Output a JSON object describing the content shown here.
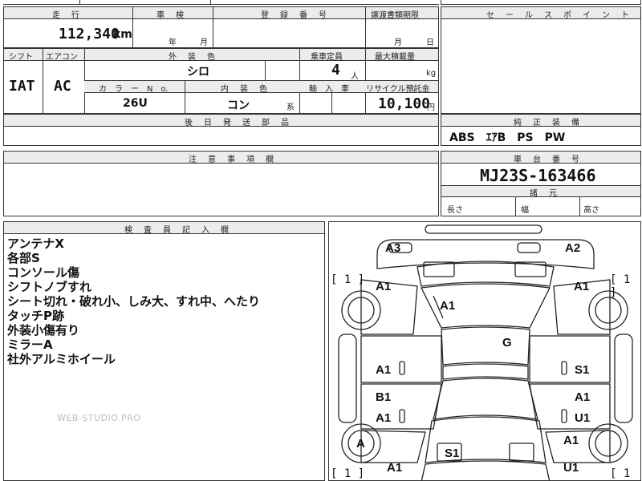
{
  "top_fragment": "",
  "mileage_block": {
    "header_mileage": "走　行",
    "header_inspection": "車　検",
    "header_reg_no": "登　録　番　号",
    "header_transfer_deadline": "譲渡書類期限",
    "mileage_value": "112,340",
    "mileage_unit": "km",
    "year_unit": "年",
    "month_unit": "月",
    "deadline_month": "月",
    "deadline_day": "日"
  },
  "spec_block": {
    "shift_header": "シフト",
    "aircon_header": "エアコン",
    "exterior_color_header": "外　装　色",
    "capacity_header": "乗車定員",
    "max_load_header": "最大積載量",
    "shift_value": "IAT",
    "aircon_value": "AC",
    "exterior_color_value": "シロ",
    "capacity_value": "4",
    "capacity_unit": "人",
    "load_unit": "kg",
    "color_no_header": "カ　ラ　ー　N　o.",
    "interior_color_header": "内　装　色",
    "import_header": "輸　入　車",
    "recycle_header": "リサイクル預託金",
    "color_no_value": "26U",
    "interior_color_value": "コン",
    "interior_suffix": "系",
    "recycle_value": "10,100",
    "recycle_unit": "円"
  },
  "parts_block": {
    "header": "後　日　発　送　部　品"
  },
  "caution_block": {
    "header": "注　意　事　項　欄"
  },
  "sales_point": {
    "header": "セ　ー　ル　ス　ポ　イ　ン　ト"
  },
  "genuine_equipment": {
    "header": "純　正　装　備",
    "value": "ABS　ｴｱB　PS　PW"
  },
  "chassis": {
    "header": "車　台　番　号",
    "value": "MJ23S-163466",
    "dims_header": "諸　元",
    "length_label": "長さ",
    "width_label": "幅",
    "height_label": "高さ"
  },
  "inspector_notes": {
    "header": "検　査　員　記　入　欄",
    "lines": [
      "アンテナX",
      "各部S",
      "コンソール傷",
      "シフトノブすれ",
      "シート切れ・破れ小、しみ大、すれ中、へたり",
      "タッチP跡",
      "外装小傷有り",
      "ミラーA",
      "社外アルミホイール"
    ]
  },
  "watermark": "WEB-STUDIO.PRO",
  "car_diagram": {
    "marks": {
      "roof_front_left": "A3",
      "roof_front_right": "A2",
      "fender_left_front": "A1",
      "fender_right_front": "A1",
      "windshield": "A1",
      "roof": "G",
      "door_front_left": "A1",
      "door_front_right": "S1",
      "door_rear_left_upper": "B1",
      "door_rear_right_upper": "A1",
      "door_rear_left_lower": "A1",
      "door_rear_right_lower": "U1",
      "wheel_rear_left": "A",
      "quarter_right": "A1",
      "tailgate": "S1",
      "bumper_rear_left": "A1",
      "bumper_rear_right": "U1"
    },
    "brackets": {
      "front_left": "[ 1 ]",
      "front_right": "[ 1 ]",
      "rear_left": "[ 1 ]",
      "rear_right": "[ 1 ]"
    }
  }
}
